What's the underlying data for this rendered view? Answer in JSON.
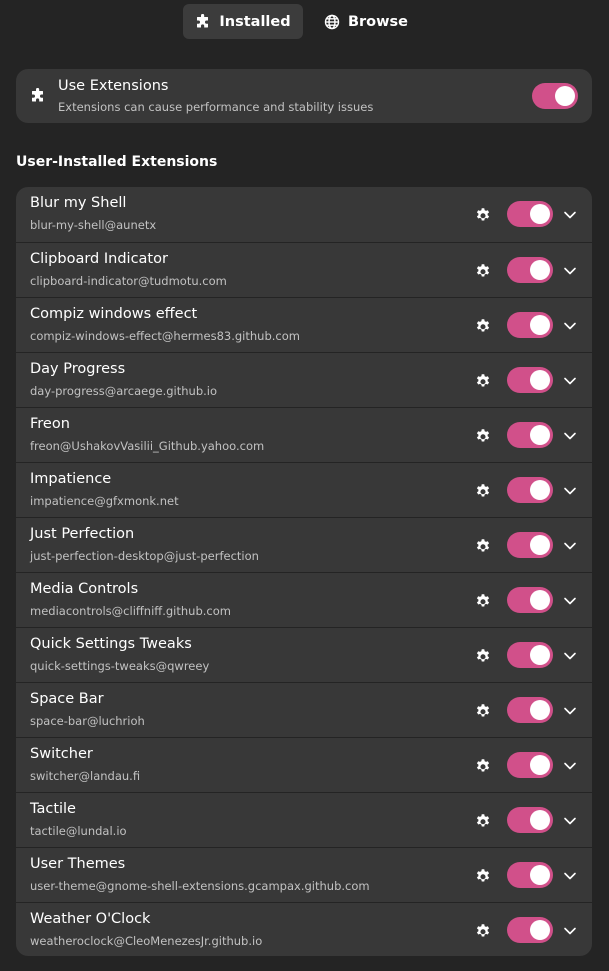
{
  "tabs": [
    {
      "label": "Installed",
      "icon": "puzzle-icon",
      "selected": true
    },
    {
      "label": "Browse",
      "icon": "globe-icon",
      "selected": false
    }
  ],
  "use_extensions": {
    "title": "Use Extensions",
    "subtitle": "Extensions can cause performance and stability issues",
    "icon": "puzzle-icon",
    "enabled": true
  },
  "section": {
    "heading": "User-Installed Extensions"
  },
  "colors": {
    "accent": "#d1508a",
    "background": "#242424",
    "card": "#383838"
  },
  "extensions": [
    {
      "name": "Blur my Shell",
      "uuid": "blur-my-shell@aunetx",
      "enabled": true
    },
    {
      "name": "Clipboard Indicator",
      "uuid": "clipboard-indicator@tudmotu.com",
      "enabled": true
    },
    {
      "name": "Compiz windows effect",
      "uuid": "compiz-windows-effect@hermes83.github.com",
      "enabled": true
    },
    {
      "name": "Day Progress",
      "uuid": "day-progress@arcaege.github.io",
      "enabled": true
    },
    {
      "name": "Freon",
      "uuid": "freon@UshakovVasilii_Github.yahoo.com",
      "enabled": true
    },
    {
      "name": "Impatience",
      "uuid": "impatience@gfxmonk.net",
      "enabled": true
    },
    {
      "name": "Just Perfection",
      "uuid": "just-perfection-desktop@just-perfection",
      "enabled": true
    },
    {
      "name": "Media Controls",
      "uuid": "mediacontrols@cliffniff.github.com",
      "enabled": true
    },
    {
      "name": "Quick Settings Tweaks",
      "uuid": "quick-settings-tweaks@qwreey",
      "enabled": true
    },
    {
      "name": "Space Bar",
      "uuid": "space-bar@luchrioh",
      "enabled": true
    },
    {
      "name": "Switcher",
      "uuid": "switcher@landau.fi",
      "enabled": true
    },
    {
      "name": "Tactile",
      "uuid": "tactile@lundal.io",
      "enabled": true
    },
    {
      "name": "User Themes",
      "uuid": "user-theme@gnome-shell-extensions.gcampax.github.com",
      "enabled": true
    },
    {
      "name": "Weather O'Clock",
      "uuid": "weatheroclock@CleoMenezesJr.github.io",
      "enabled": true
    }
  ]
}
